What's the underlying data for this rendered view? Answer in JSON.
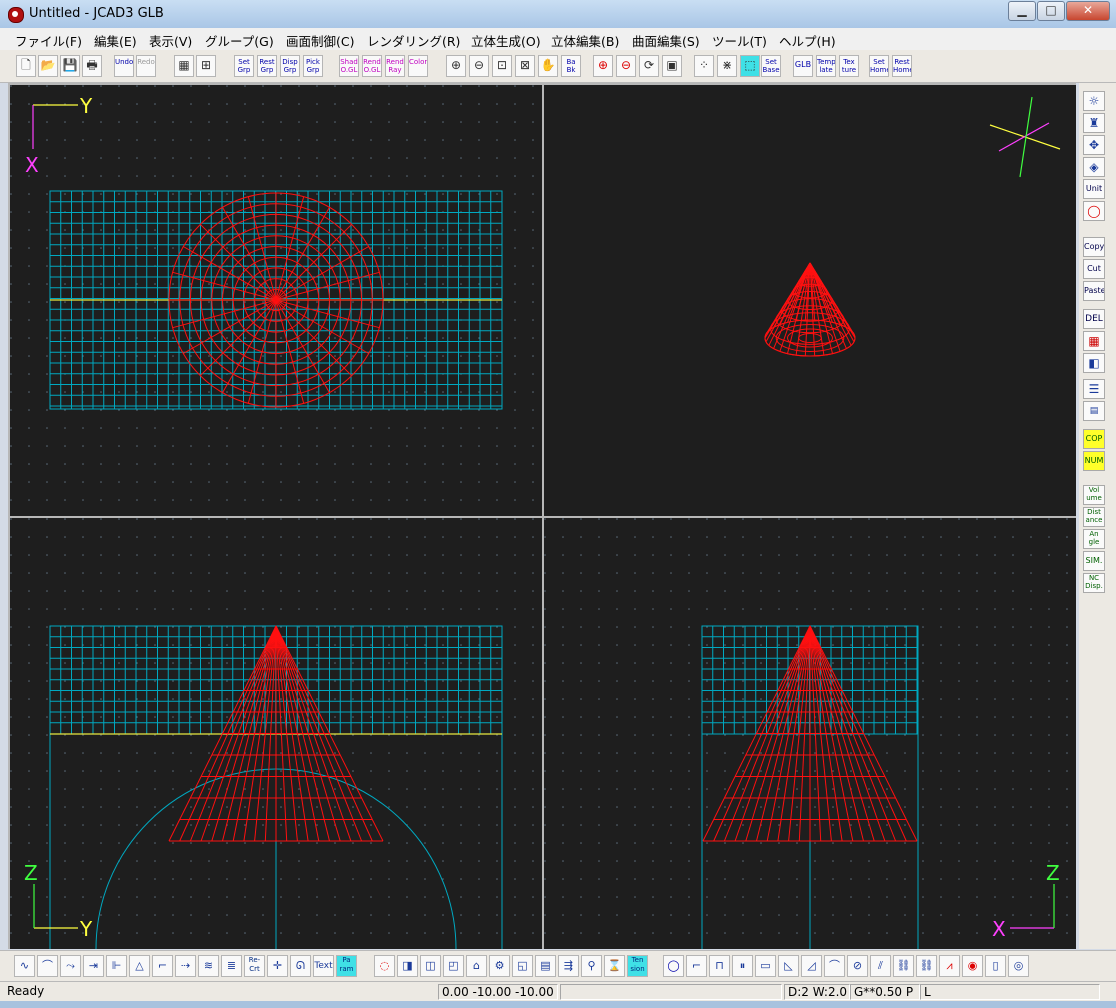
{
  "window": {
    "title": "Untitled - JCAD3 GLB",
    "minimize": "▁",
    "maximize": "□",
    "close": "✕"
  },
  "menu": [
    "ファイル(F)",
    "編集(E)",
    "表示(V)",
    "グループ(G)",
    "画面制御(C)",
    "レンダリング(R)",
    "立体生成(O)",
    "立体編集(B)",
    "曲面編集(S)",
    "ツール(T)",
    "ヘルプ(H)"
  ],
  "toolbar": {
    "new": "new-file-icon",
    "open": "open-folder-icon",
    "save": "save-icon",
    "print": "print-icon",
    "undo": "Undo",
    "redo": "Redo",
    "set_grp": "Set Grp",
    "rest_grp": "Rest Grp",
    "disp_grp": "Disp Grp",
    "pick_grp": "Pick Grp",
    "shad_ogl": "Shad O.GL",
    "rend_ogl": "Rend O.GL",
    "rend_ray": "Rend Ray",
    "color": "Color",
    "back": "Ba Bk",
    "set_base": "Set Base",
    "glb": "GLB",
    "template": "Temp late",
    "texture": "Tex ture",
    "set_home": "Set Home",
    "rest_home": "Rest Home"
  },
  "views": {
    "top_left_axes": {
      "horizontal": "Y",
      "vertical": "X"
    },
    "bottom_left_axes": {
      "horizontal": "Y",
      "vertical": "Z"
    },
    "bottom_right_axes": {
      "horizontal": "X",
      "vertical": "Z"
    }
  },
  "rightbar": {
    "unit": "Unit",
    "copy": "Copy",
    "cut": "Cut",
    "paste": "Paste",
    "del": "DEL",
    "cop": "COP",
    "num": "NUM",
    "volume": "Vol ume",
    "distance": "Dist ance",
    "angle": "An gle",
    "sim": "SIM.",
    "nc": "NC Disp."
  },
  "bottombar": {
    "re_crt": "Re- Crt",
    "text": "Text",
    "pa_ram": "Pa ram",
    "tension": "Ten sion"
  },
  "status": {
    "ready": "Ready",
    "coords": "0.00 -10.00 -10.00",
    "info": "D:2 W:2.0",
    "grid": "G**0.50 P",
    "mode": "L"
  },
  "colors": {
    "viewport_bg": "#1e1e1e",
    "grid": "#00b0c8",
    "model": "#ff1010",
    "axis_yellow": "#ffff40",
    "axis_magenta": "#ff40ff",
    "axis_green": "#40ff40"
  }
}
